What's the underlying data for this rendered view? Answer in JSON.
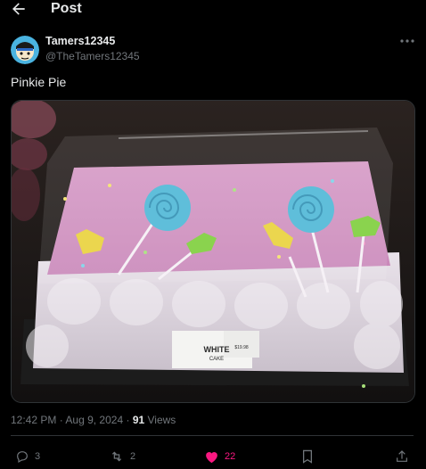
{
  "header": {
    "title": "Post"
  },
  "author": {
    "display_name": "Tamers12345",
    "handle": "@TheTamers12345"
  },
  "post": {
    "text": "Pinkie Pie",
    "image_alt": "Pink frosted white sheet cake with blue lollipop and green candy decorations in a clear plastic container",
    "cake_label": {
      "brand": "WHITE",
      "subtitle": "CAKE",
      "price_lines": [
        "$19.98"
      ]
    }
  },
  "meta": {
    "time": "12:42 PM",
    "date": "Aug 9, 2024",
    "dot": "·",
    "views_count": "91",
    "views_label": "Views"
  },
  "actions": {
    "replies": "3",
    "reposts": "2",
    "likes": "22"
  },
  "colors": {
    "like": "#f91880",
    "muted": "#71767b",
    "text": "#e7e9ea",
    "border": "#2f3336"
  }
}
